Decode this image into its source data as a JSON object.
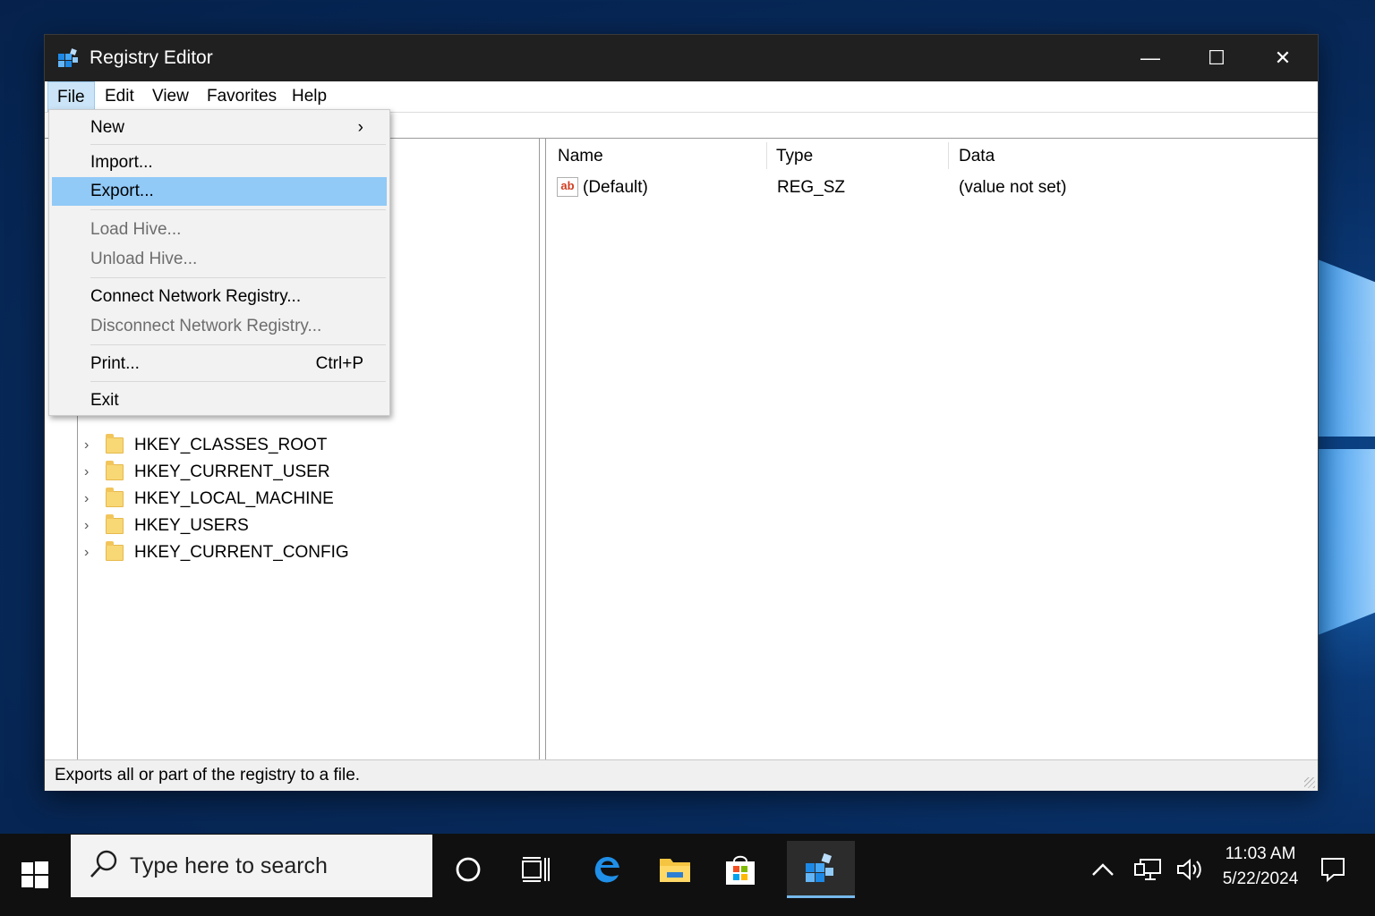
{
  "window": {
    "title": "Registry Editor",
    "controls": {
      "minimize": "—",
      "maximize": "☐",
      "close": "✕"
    }
  },
  "menubar": {
    "items": [
      "File",
      "Edit",
      "View",
      "Favorites",
      "Help"
    ],
    "active": "File"
  },
  "file_menu": {
    "new": "New",
    "import": "Import...",
    "export": "Export...",
    "load_hive": "Load Hive...",
    "unload_hive": "Unload Hive...",
    "connect": "Connect Network Registry...",
    "disconnect": "Disconnect Network Registry...",
    "print": "Print...",
    "print_shortcut": "Ctrl+P",
    "exit": "Exit",
    "submenu_glyph": "›"
  },
  "tree": {
    "items": [
      "HKEY_CLASSES_ROOT",
      "HKEY_CURRENT_USER",
      "HKEY_LOCAL_MACHINE",
      "HKEY_USERS",
      "HKEY_CURRENT_CONFIG"
    ]
  },
  "list": {
    "columns": [
      "Name",
      "Type",
      "Data"
    ],
    "rows": [
      {
        "icon": "ab",
        "name": "(Default)",
        "type": "REG_SZ",
        "data": "(value not set)"
      }
    ]
  },
  "status": "Exports all or part of the registry to a file.",
  "taskbar": {
    "search_placeholder": "Type here to search",
    "time": "11:03 AM",
    "date": "5/22/2024"
  },
  "colors": {
    "titlebar": "#202020",
    "menu_hover": "#91c9f7",
    "taskbar": "#101010",
    "accent": "#76b9ed"
  }
}
